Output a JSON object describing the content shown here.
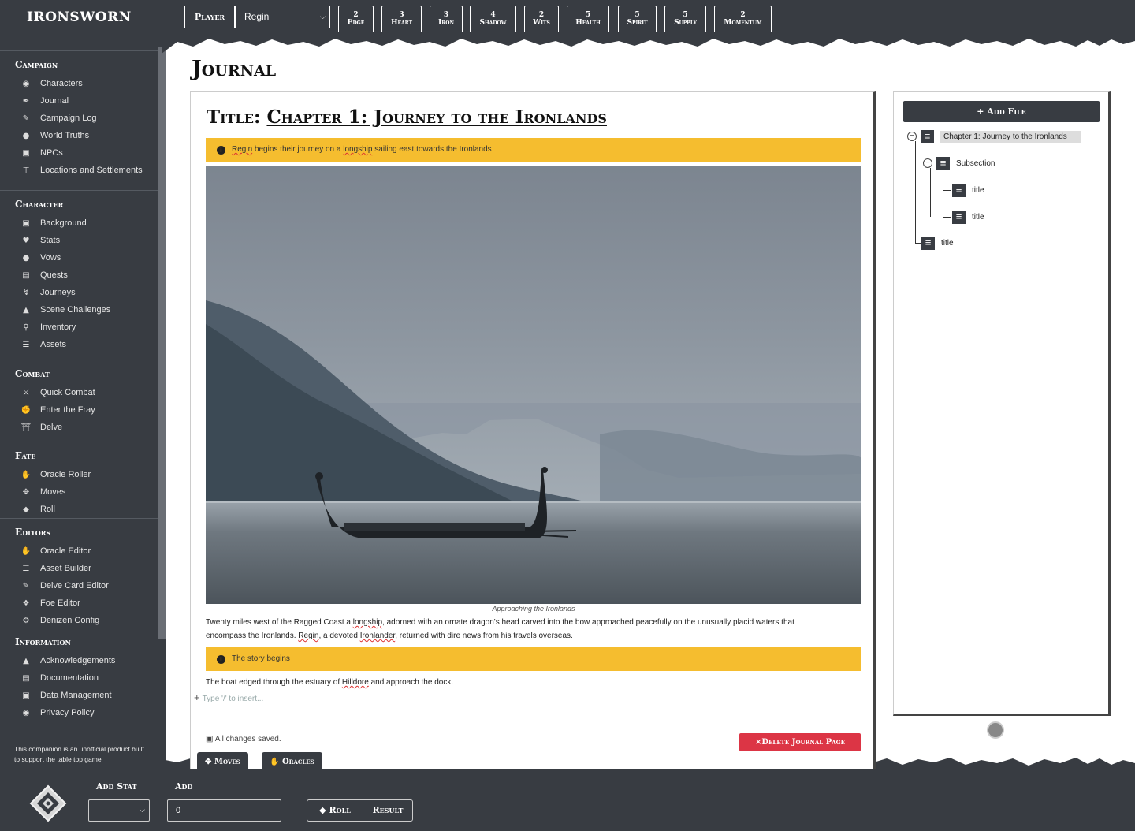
{
  "app": {
    "name": "IRONSWORN"
  },
  "player": {
    "label": "Player",
    "selected": "Regin"
  },
  "stats": [
    {
      "value": "2",
      "name": "Edge"
    },
    {
      "value": "3",
      "name": "Heart"
    },
    {
      "value": "3",
      "name": "Iron"
    },
    {
      "value": "4",
      "name": "Shadow"
    },
    {
      "value": "2",
      "name": "Wits"
    },
    {
      "value": "5",
      "name": "Health"
    },
    {
      "value": "5",
      "name": "Spirit"
    },
    {
      "value": "5",
      "name": "Supply"
    },
    {
      "value": "2",
      "name": "Momentum"
    }
  ],
  "sidebar": {
    "sections": [
      {
        "title": "Campaign",
        "items": [
          {
            "label": "Characters",
            "icon": "users-icon"
          },
          {
            "label": "Journal",
            "icon": "feather-icon"
          },
          {
            "label": "Campaign Log",
            "icon": "pen-icon"
          },
          {
            "label": "World Truths",
            "icon": "globe-icon"
          },
          {
            "label": "NPCs",
            "icon": "id-card-icon"
          },
          {
            "label": "Locations and Settlements",
            "icon": "signpost-icon"
          }
        ]
      },
      {
        "title": "Character",
        "items": [
          {
            "label": "Background",
            "icon": "address-card-icon"
          },
          {
            "label": "Stats",
            "icon": "heartbeat-icon"
          },
          {
            "label": "Vows",
            "icon": "comment-icon"
          },
          {
            "label": "Quests",
            "icon": "scroll-icon"
          },
          {
            "label": "Journeys",
            "icon": "hiking-icon"
          },
          {
            "label": "Scene Challenges",
            "icon": "mountain-icon"
          },
          {
            "label": "Inventory",
            "icon": "flask-icon"
          },
          {
            "label": "Assets",
            "icon": "layers-icon"
          }
        ]
      },
      {
        "title": "Combat",
        "items": [
          {
            "label": "Quick Combat",
            "icon": "swords-icon"
          },
          {
            "label": "Enter the Fray",
            "icon": "fist-icon"
          },
          {
            "label": "Delve",
            "icon": "dungeon-icon"
          }
        ]
      },
      {
        "title": "Fate",
        "items": [
          {
            "label": "Oracle Roller",
            "icon": "hand-icon"
          },
          {
            "label": "Moves",
            "icon": "arrows-icon"
          },
          {
            "label": "Roll",
            "icon": "dice-icon"
          }
        ]
      },
      {
        "title": "Editors",
        "items": [
          {
            "label": "Oracle Editor",
            "icon": "hand-icon"
          },
          {
            "label": "Asset Builder",
            "icon": "layers-icon"
          },
          {
            "label": "Delve Card Editor",
            "icon": "pen-icon"
          },
          {
            "label": "Foe Editor",
            "icon": "dragon-icon"
          },
          {
            "label": "Denizen Config",
            "icon": "gear-icon"
          }
        ]
      },
      {
        "title": "Information",
        "items": [
          {
            "label": "Acknowledgements",
            "icon": "thumbs-up-icon"
          },
          {
            "label": "Documentation",
            "icon": "book-icon"
          },
          {
            "label": "Data Management",
            "icon": "save-icon"
          },
          {
            "label": "Privacy Policy",
            "icon": "user-shield-icon"
          }
        ]
      }
    ],
    "disclaimer": "This companion is an unofficial product built to support the table top game"
  },
  "page": {
    "title": "Journal"
  },
  "document": {
    "title_prefix": "Title: ",
    "title": "Chapter 1: Journey to the Ironlands",
    "callout1_name": "Regin",
    "callout1_mid": " begins their journey on a ",
    "callout1_ship": "longship",
    "callout1_end": " sailing east towards the Ironlands",
    "image_caption": "Approaching the Ironlands",
    "para1_a": "Twenty miles west of the Ragged Coast a ",
    "para1_b": "longship",
    "para1_c": ", adorned with an ornate dragon's head carved into the bow approached peacefully on the unusually placid waters that encompass the Ironlands. ",
    "para1_d": "Regin",
    "para1_e": ", a devoted ",
    "para1_f": "Ironlander",
    "para1_g": ", returned with dire news from his travels overseas.",
    "callout2": "The story begins",
    "para2_a": "The boat edged through the estuary of ",
    "para2_b": "Hilldore",
    "para2_c": " and approach the dock.",
    "insert_placeholder": "Type '/' to insert...",
    "saved_status": "All changes saved.",
    "delete_label": "Delete Journal Page"
  },
  "tabs": {
    "moves": "Moves",
    "oracles": "Oracles"
  },
  "tree": {
    "add_file_label": "Add File",
    "nodes": {
      "chapter": "Chapter 1: Journey to the Ironlands",
      "subsection": "Subsection",
      "child1": "title",
      "child2": "title",
      "root2": "title"
    }
  },
  "bottombar": {
    "add_stat_label": "Add Stat",
    "add_label": "Add",
    "add_value": "0",
    "roll_label": "Roll",
    "result_label": "Result"
  },
  "colors": {
    "dark": "#383c42",
    "callout": "#f5bd2f",
    "danger": "#dc3545"
  }
}
